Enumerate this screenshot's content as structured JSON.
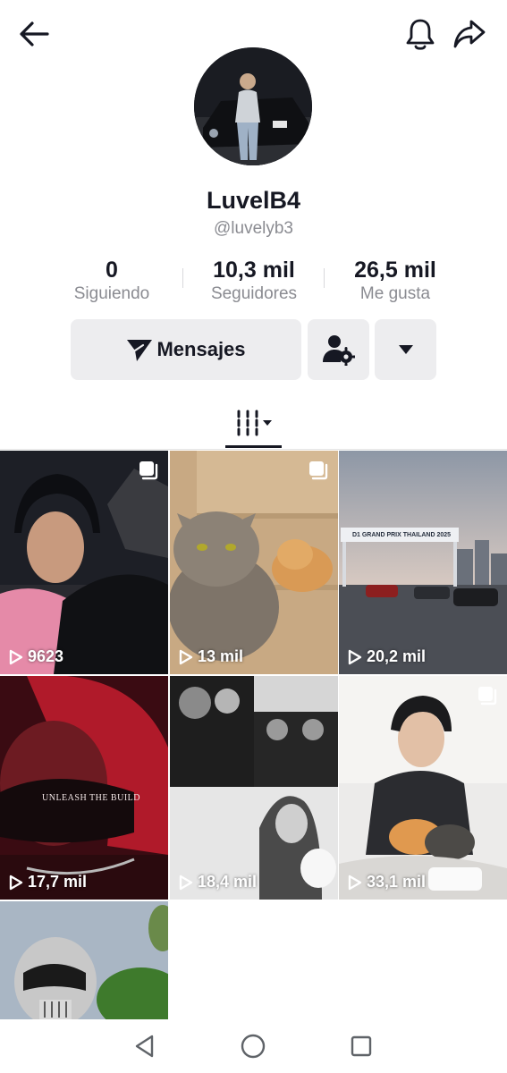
{
  "profile": {
    "display_name": "LuvelB4",
    "handle": "@luvelyb3"
  },
  "stats": [
    {
      "value": "0",
      "label": "Siguiendo"
    },
    {
      "value": "10,3 mil",
      "label": "Seguidores"
    },
    {
      "value": "26,5 mil",
      "label": "Me gusta"
    }
  ],
  "actions": {
    "message_label": "Mensajes"
  },
  "videos": [
    {
      "views": "9623",
      "multi": true
    },
    {
      "views": "13 mil",
      "multi": true
    },
    {
      "views": "20,2 mil",
      "multi": false,
      "banner_text": "D1 GRAND PRIX THAILAND 2025"
    },
    {
      "views": "17,7 mil",
      "multi": false,
      "overlay_text": "UNLEASH THE BUILD"
    },
    {
      "views": "18,4 mil",
      "multi": false
    },
    {
      "views": "33,1 mil",
      "multi": true
    },
    {
      "views": "",
      "multi": false
    }
  ],
  "icons": {
    "back": "arrow-left-icon",
    "bell": "bell-icon",
    "share": "share-arrow-icon",
    "send": "paper-plane-icon",
    "add_friend": "person-gear-icon",
    "more": "caret-down-icon",
    "videos_tab": "video-grid-icon",
    "play": "play-icon",
    "multi": "multi-photo-icon"
  },
  "colors": {
    "text_primary": "#161823",
    "text_secondary": "#8a8b91",
    "button_bg": "#ededef"
  }
}
